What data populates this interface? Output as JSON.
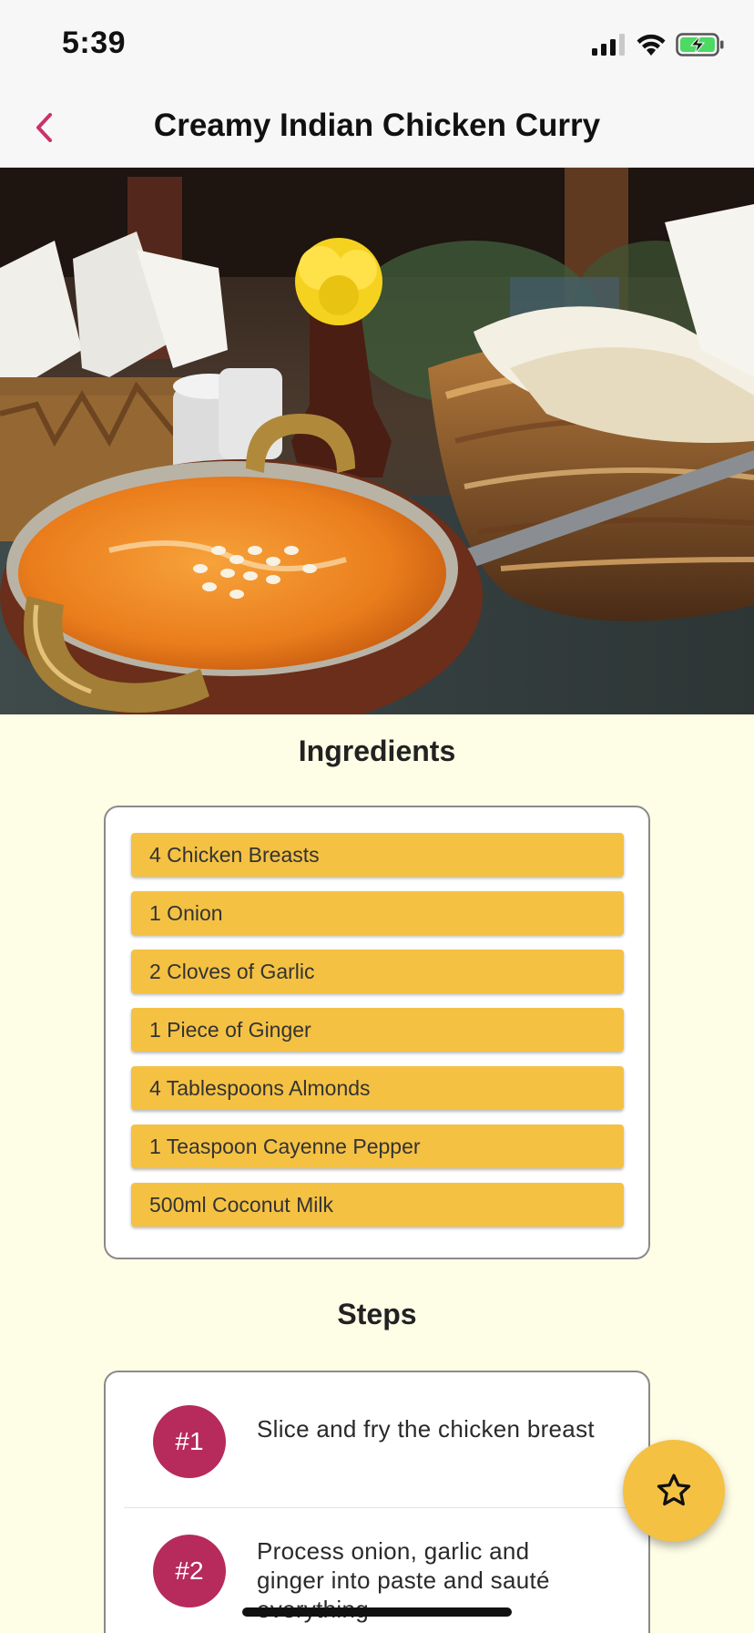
{
  "status_bar": {
    "time": "5:39"
  },
  "header": {
    "title": "Creamy Indian Chicken Curry"
  },
  "ingredients": {
    "title": "Ingredients",
    "items": [
      "4 Chicken Breasts",
      "1 Onion",
      "2 Cloves of Garlic",
      "1 Piece of Ginger",
      "4 Tablespoons Almonds",
      "1 Teaspoon Cayenne Pepper",
      "500ml Coconut Milk"
    ]
  },
  "steps": {
    "title": "Steps",
    "items": [
      {
        "badge": "#1",
        "text": "Slice and fry the chicken breast"
      },
      {
        "badge": "#2",
        "text": "Process onion, garlic and ginger into paste and sauté everything"
      }
    ]
  },
  "fab": {
    "icon": "star-outline-icon"
  },
  "colors": {
    "accent": "#b72a5c",
    "ingredient_bg": "#f4c143",
    "page_bg": "#fefde6",
    "appbar_bg": "#f7f7f7"
  }
}
